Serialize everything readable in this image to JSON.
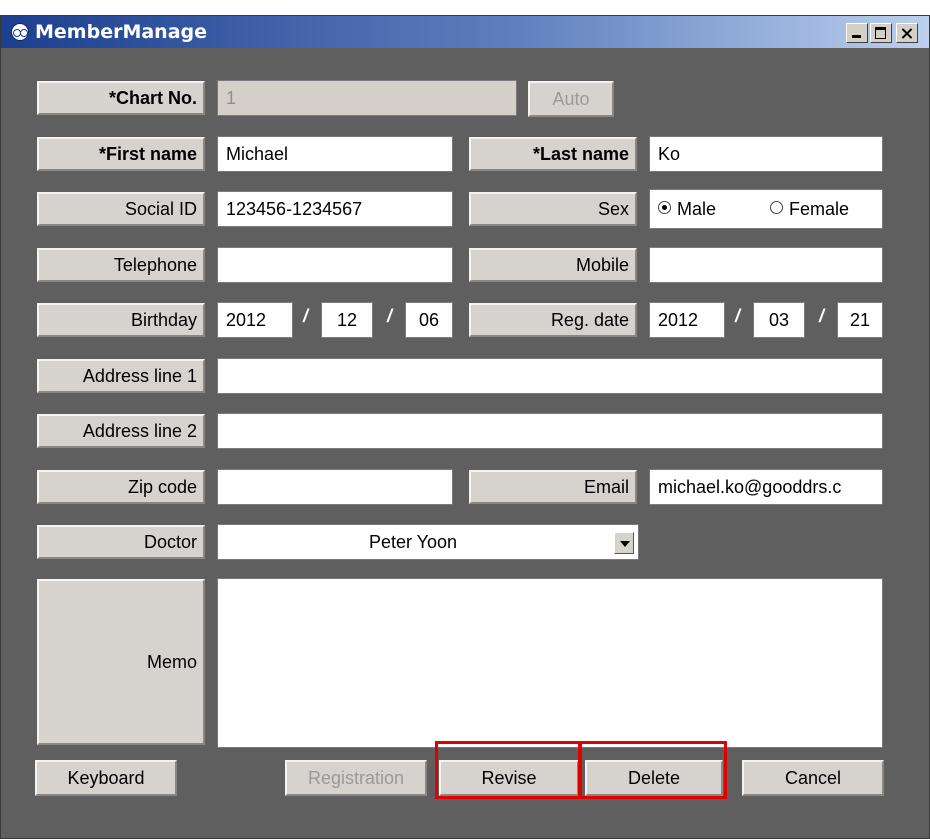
{
  "window": {
    "title": "MemberManage"
  },
  "form": {
    "chart_no": {
      "label": "*Chart No.",
      "value": "1",
      "auto_button": "Auto"
    },
    "first_name": {
      "label": "*First name",
      "value": "Michael"
    },
    "last_name": {
      "label": "*Last name",
      "value": "Ko"
    },
    "social_id": {
      "label": "Social ID",
      "value": "123456-1234567"
    },
    "sex": {
      "label": "Sex",
      "options": [
        "Male",
        "Female"
      ],
      "selected": "Male"
    },
    "telephone": {
      "label": "Telephone",
      "value": ""
    },
    "mobile": {
      "label": "Mobile",
      "value": ""
    },
    "birthday": {
      "label": "Birthday",
      "year": "2012",
      "month": "12",
      "day": "06",
      "separator": "/"
    },
    "reg_date": {
      "label": "Reg. date",
      "year": "2012",
      "month": "03",
      "day": "21"
    },
    "address1": {
      "label": "Address line 1",
      "value": ""
    },
    "address2": {
      "label": "Address line 2",
      "value": ""
    },
    "zip_code": {
      "label": "Zip code",
      "value": ""
    },
    "email": {
      "label": "Email",
      "value": "michael.ko@gooddrs.c"
    },
    "doctor": {
      "label": "Doctor",
      "selected": "Peter Yoon"
    },
    "memo": {
      "label": "Memo",
      "value": ""
    }
  },
  "buttons": {
    "keyboard": "Keyboard",
    "registration": "Registration",
    "revise": "Revise",
    "delete": "Delete",
    "cancel": "Cancel"
  },
  "colors": {
    "window_bg": "#5f5f5f",
    "highlight": "#e00000",
    "label_bg": "#d6d3cf"
  }
}
